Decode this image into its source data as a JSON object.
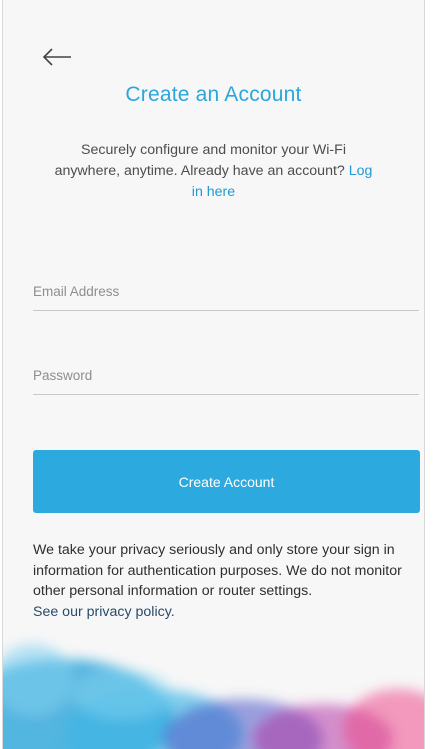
{
  "header": {
    "back_icon": "arrow-left-icon",
    "title": "Create an Account"
  },
  "intro": {
    "text": "Securely configure and monitor your Wi-Fi anywhere, anytime. Already have an account?",
    "login_link": "Log in here"
  },
  "form": {
    "email_placeholder": "Email Address",
    "email_value": "",
    "password_placeholder": "Password",
    "password_value": "",
    "submit_label": "Create Account"
  },
  "privacy": {
    "text": "We take your privacy seriously and only store your sign in information for authentication purposes. We do not monitor other personal information or router settings.",
    "link": "See our privacy policy."
  },
  "colors": {
    "accent": "#2ca9df",
    "title": "#2ba6dc",
    "link": "#1f9ad5",
    "background": "#f7f7f7"
  }
}
